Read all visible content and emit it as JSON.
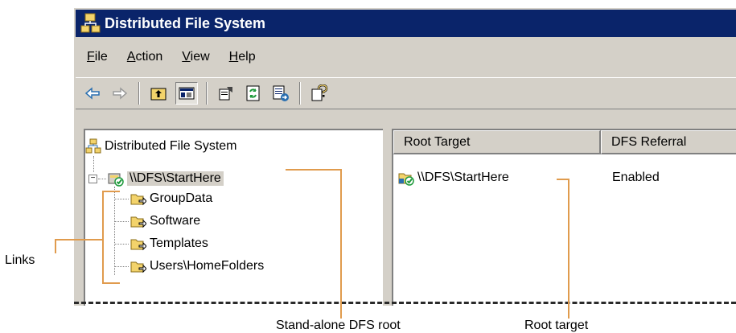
{
  "window": {
    "title": "Distributed File System"
  },
  "menubar": {
    "items": [
      {
        "label": "File",
        "accel": "F",
        "rest": "ile"
      },
      {
        "label": "Action",
        "accel": "A",
        "rest": "ction"
      },
      {
        "label": "View",
        "accel": "V",
        "rest": "iew"
      },
      {
        "label": "Help",
        "accel": "H",
        "rest": "elp"
      }
    ]
  },
  "toolbar": {
    "buttons": [
      "back-arrow-icon",
      "forward-arrow-icon",
      "up-folder-icon",
      "show-hide-tree-icon",
      "properties-icon",
      "refresh-icon",
      "export-list-icon",
      "help-icon"
    ]
  },
  "tree": {
    "root_label": "Distributed File System",
    "dfs_root_label": "\\\\DFS\\StartHere",
    "links": [
      "GroupData",
      "Software",
      "Templates",
      "Users\\HomeFolders"
    ]
  },
  "list": {
    "columns": [
      "Root Target",
      "DFS Referral"
    ],
    "rows": [
      {
        "target": "\\\\DFS\\StartHere",
        "referral": "Enabled"
      }
    ]
  },
  "annotations": {
    "links": "Links",
    "standalone_root": "Stand-alone DFS root",
    "root_target": "Root target"
  },
  "colors": {
    "titlebar": "#0a246a",
    "chrome": "#d4d0c8",
    "callout": "#e09b4d",
    "folder": "#f3d36b",
    "check": "#1e9a3b"
  }
}
